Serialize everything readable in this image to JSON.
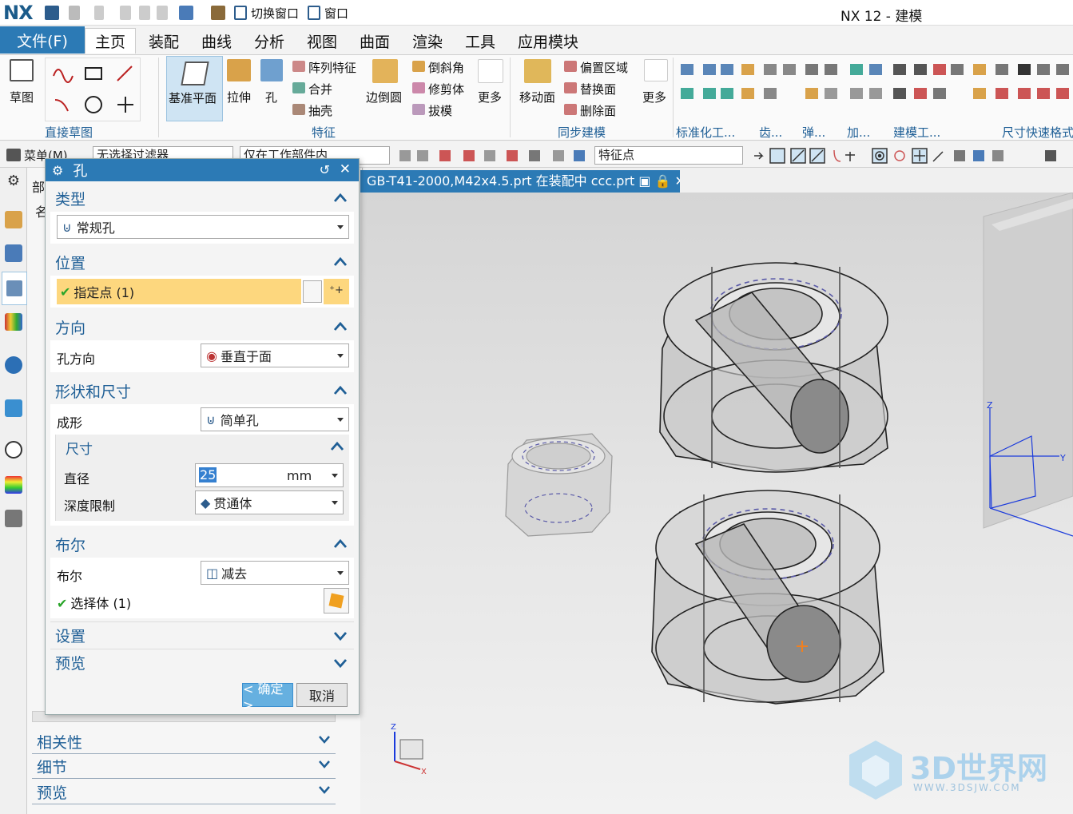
{
  "app": {
    "logo": "NX",
    "title": "NX 12 - 建模",
    "switch_window": "切换窗口",
    "window_menu": "窗口"
  },
  "menu": {
    "file": "文件(F)",
    "tabs": [
      "主页",
      "装配",
      "曲线",
      "分析",
      "视图",
      "曲面",
      "渲染",
      "工具",
      "应用模块"
    ]
  },
  "ribbon": {
    "sketch": "草图",
    "direct_sketch_group": "直接草图",
    "datum_plane": "基准平面",
    "extrude": "拉伸",
    "hole": "孔",
    "pattern_feature": "阵列特征",
    "unite": "合并",
    "shell": "抽壳",
    "edge_blend": "边倒圆",
    "chamfer": "倒斜角",
    "trim_body": "修剪体",
    "draft": "拔模",
    "more": "更多",
    "feature_group": "特征",
    "move_face": "移动面",
    "offset_region": "偏置区域",
    "replace_face": "替换面",
    "delete_face": "删除面",
    "more2": "更多",
    "sync_group": "同步建模",
    "standard_parts": "标准化工...",
    "gear": "齿...",
    "spring": "弹...",
    "add": "加...",
    "modeling_tools": "建模工...",
    "quick_dim": "尺寸快速格式"
  },
  "toolbar2": {
    "menu": "菜单(M)",
    "filter": "无选择过滤器",
    "scope": "仅在工作部件内",
    "snap": "特征点"
  },
  "doc_tab": "GB-T41-2000,M42x4.5.prt 在装配中 ccc.prt",
  "nav": {
    "header": "部",
    "col": "名",
    "sections": [
      "相关性",
      "细节",
      "预览"
    ]
  },
  "dialog": {
    "title": "孔",
    "type": {
      "header": "类型",
      "value": "常规孔"
    },
    "position": {
      "header": "位置",
      "specify_point": "指定点 (1)"
    },
    "direction": {
      "header": "方向",
      "hole_dir_label": "孔方向",
      "hole_dir_value": "垂直于面"
    },
    "shape": {
      "header": "形状和尺寸",
      "form_label": "成形",
      "form_value": "简单孔",
      "dims": {
        "header": "尺寸",
        "diameter_label": "直径",
        "diameter_value": "25",
        "diameter_unit": "mm",
        "depth_label": "深度限制",
        "depth_value": "贯通体"
      }
    },
    "boolean": {
      "header": "布尔",
      "bool_label": "布尔",
      "bool_value": "减去",
      "select_body": "选择体 (1)"
    },
    "settings": "设置",
    "preview": "预览",
    "ok": "< 确定 >",
    "cancel": "取消"
  },
  "watermark": {
    "brand": "3D世界网",
    "url": "WWW.3DSJW.COM"
  },
  "axes": {
    "x": "X",
    "y": "Y",
    "z": "Z"
  },
  "colors": {
    "accent": "#2c7ab5",
    "highlight": "#fdd77e",
    "check": "#2aa52a"
  }
}
